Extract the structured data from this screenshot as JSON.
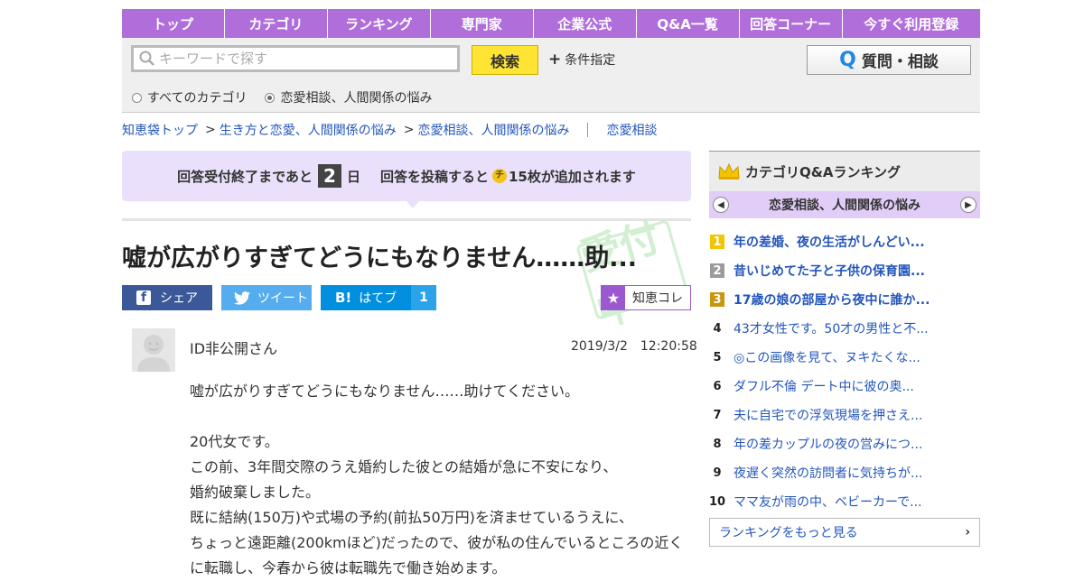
{
  "nav": [
    "トップ",
    "カテゴリ",
    "ランキング",
    "専門家",
    "企業公式",
    "Q&A一覧",
    "回答コーナー",
    "今すぐ利用登録"
  ],
  "search": {
    "placeholder": "キーワードで探す",
    "button": "検索",
    "condition": "条件指定",
    "ask_q": "Q",
    "ask_label": "質問・相談",
    "radio_all": "すべてのカテゴリ",
    "radio_cat": "恋愛相談、人間関係の悩み",
    "selected": "radio_cat"
  },
  "breadcrumb": {
    "home": "知恵袋トップ",
    "sep": ">",
    "level1": "生き方と恋愛、人間関係の悩み",
    "level2": "恋愛相談、人間関係の悩み",
    "level3": "恋愛相談"
  },
  "notice": {
    "pre": "回答受付終了まであと",
    "days": "2",
    "unit": "日",
    "post": "回答を投稿すると",
    "coin": "チ",
    "reward": "15枚が追加されます"
  },
  "question": {
    "title": "嘘が広がりすぎてどうにもなりません……助...",
    "stamp": "受付中",
    "share_fb": "シェア",
    "share_tw": "ツイート",
    "share_hb_icon": "B!",
    "share_hb": "はてブ",
    "share_hb_count": "1",
    "chiekore": "知恵コレ",
    "author": "ID非公開さん",
    "date": "2019/3/2　12:20:58",
    "body": [
      "嘘が広がりすぎてどうにもなりません……助けてください。",
      "",
      "20代女です。",
      "この前、3年間交際のうえ婚約した彼との結婚が急に不安になり、",
      "婚約破棄しました。",
      "既に結納(150万)や式場の予約(前払50万円)を済ませているうえに、",
      "ちょっと遠距離(200kmほど)だったので、彼が私の住んでいるところの近く",
      "に転職し、今春から彼は転職先で働き始めます。"
    ]
  },
  "sidebar": {
    "title": "カテゴリQ&Aランキング",
    "category": "恋愛相談、人間関係の悩み",
    "ranking": [
      {
        "n": "1",
        "t": "年の差婚、夜の生活がしんどい..."
      },
      {
        "n": "2",
        "t": "昔いじめてた子と子供の保育園..."
      },
      {
        "n": "3",
        "t": "17歳の娘の部屋から夜中に誰か..."
      },
      {
        "n": "4",
        "t": "43才女性です。50才の男性と不..."
      },
      {
        "n": "5",
        "t": "◎この画像を見て、ヌキたくな..."
      },
      {
        "n": "6",
        "t": "ダフル不倫 デート中に彼の奥..."
      },
      {
        "n": "7",
        "t": "夫に自宅での浮気現場を押さえ..."
      },
      {
        "n": "8",
        "t": "年の差カップルの夜の営みにつ..."
      },
      {
        "n": "9",
        "t": "夜遅く突然の訪問者に気持ちが..."
      },
      {
        "n": "10",
        "t": "ママ友が雨の中、ベビーカーで..."
      }
    ],
    "more": "ランキングをもっと見る"
  }
}
